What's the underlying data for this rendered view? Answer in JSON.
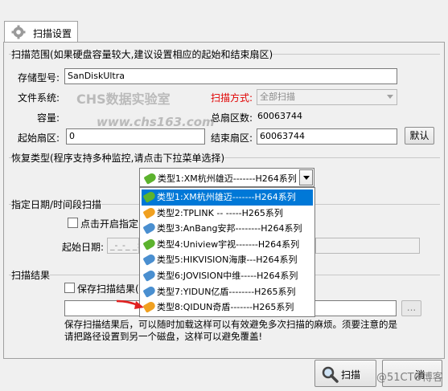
{
  "tab": {
    "label": "扫描设置",
    "icon": "gear-icon"
  },
  "scan_range": {
    "title": "扫描范围(如果硬盘容量较大,建议设置相应的起始和结束扇区)",
    "model_label": "存储型号:",
    "model_value": "SanDiskUltra",
    "fs_label": "文件系统:",
    "mode_label": "扫描方式:",
    "mode_value": "全部扫描",
    "capacity_label": "容量:",
    "total_sectors_label": "总扇区数:",
    "total_sectors_value": "60063744",
    "start_label": "起始扇区:",
    "start_value": "0",
    "end_label": "结束扇区:",
    "end_value": "60063744",
    "default_button": "默认"
  },
  "recovery_type": {
    "title": "恢复类型(程序支持多种监控,请点击下拉菜单选择)",
    "selected": "类型1:XM杭州雄迈-------H264系列",
    "options": [
      {
        "label": "类型1:XM杭州雄迈-------H264系列",
        "color": "#5cb32e"
      },
      {
        "label": "类型2:TPLINK       -- -----H265系列",
        "color": "#f0a020"
      },
      {
        "label": "类型3:AnBang安邦--------H264系列",
        "color": "#4a8fd0"
      },
      {
        "label": "类型4:Uniview宇视-------H264系列",
        "color": "#5cb32e"
      },
      {
        "label": "类型5:HIKVISION海康---H264系列",
        "color": "#4a8fd0"
      },
      {
        "label": "类型6:JOVISION中维-----H264系列",
        "color": "#4a8fd0"
      },
      {
        "label": "类型7:YIDUN亿盾--------H265系列",
        "color": "#4a8fd0"
      },
      {
        "label": "类型8:QIDUN奇盾-------H265系列",
        "color": "#f0a020"
      }
    ]
  },
  "time_range": {
    "title": "指定日期/时间段扫描",
    "enable_label": "点击开启指定日",
    "start_date_label": "起始日期:",
    "start_date_value": "_-_-_ _:_"
  },
  "scan_result": {
    "title": "扫描结果",
    "save_label": "保存扫描结果(",
    "browse_button": "...",
    "hint": "保存扫描结果后，可以随时加载这样可以有效避免多次扫描的麻烦。须要注意的是请把路径设置到另一个磁盘，这样可以避免覆盖!"
  },
  "buttons": {
    "scan": "扫描",
    "cancel": "消"
  },
  "watermark": {
    "line1": "CHS数据实验室",
    "line2": "www.chs163.com",
    "corner": "@51CTO博客"
  }
}
